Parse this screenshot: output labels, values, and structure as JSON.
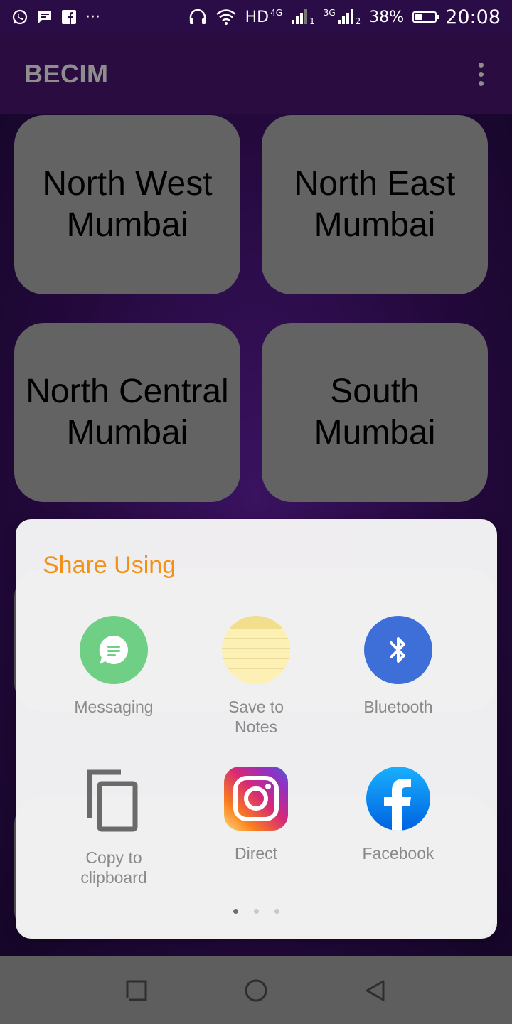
{
  "status_bar": {
    "network_label": "HD",
    "lte_label": "4G",
    "sim1_label": "1",
    "threeg_label": "3G",
    "sim2_label": "2",
    "battery_percent": "38%",
    "battery_level": 0.38,
    "time": "20:08",
    "more_label": "···"
  },
  "app_bar": {
    "title": "BECIM"
  },
  "tiles": [
    {
      "label": "North West\nMumbai"
    },
    {
      "label": "North East\nMumbai"
    },
    {
      "label": "North Central\nMumbai"
    },
    {
      "label": "South\nMumbai"
    }
  ],
  "share_sheet": {
    "title": "Share Using",
    "items": [
      {
        "label": "Messaging",
        "icon": "messaging-icon",
        "color": "#6fcf84"
      },
      {
        "label": "Save to\nNotes",
        "icon": "notes-icon",
        "color": "#fdf0b5"
      },
      {
        "label": "Bluetooth",
        "icon": "bluetooth-icon",
        "color": "#3e6fd8"
      },
      {
        "label": "Copy to\nclipboard",
        "icon": "copy-icon",
        "color": "#6a6a6a"
      },
      {
        "label": "Direct",
        "icon": "instagram-icon",
        "color": "#d62976"
      },
      {
        "label": "Facebook",
        "icon": "facebook-icon",
        "color": "#1877f2"
      }
    ],
    "pages": 3,
    "active_page": 1
  },
  "colors": {
    "accent": "#f39016",
    "app_bar": "#2b0c40",
    "tile": "#636363"
  }
}
